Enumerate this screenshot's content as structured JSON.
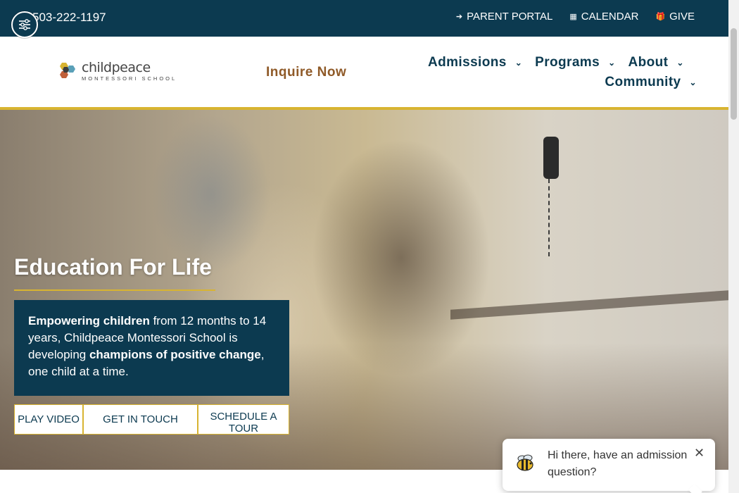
{
  "topbar": {
    "phone": "503-222-1197",
    "links": [
      {
        "label": "PARENT PORTAL",
        "icon": "sign-in-icon"
      },
      {
        "label": "CALENDAR",
        "icon": "calendar-icon"
      },
      {
        "label": "GIVE",
        "icon": "gift-icon"
      }
    ]
  },
  "header": {
    "logo_name": "childpeace",
    "logo_sub": "MONTESSORI SCHOOL",
    "inquire": "Inquire Now",
    "nav": [
      {
        "label": "Admissions"
      },
      {
        "label": "Programs"
      },
      {
        "label": "About"
      },
      {
        "label": "Community"
      }
    ]
  },
  "hero": {
    "title": "Education For Life",
    "text_bold_1": "Empowering children",
    "text_1": " from 12 months to 14 years, Childpeace Montessori School is developing ",
    "text_bold_2": "champions of positive change",
    "text_2": ", one child at a time.",
    "buttons": {
      "video": "PLAY VIDEO",
      "touch": "GET IN TOUCH",
      "tour": "SCHEDULE A TOUR"
    }
  },
  "chat": {
    "message": "Hi there, have an admission question?",
    "close": "✕"
  },
  "colors": {
    "navy": "#0c3a50",
    "gold": "#d8b431",
    "inquire_brown": "#8f5a28"
  }
}
